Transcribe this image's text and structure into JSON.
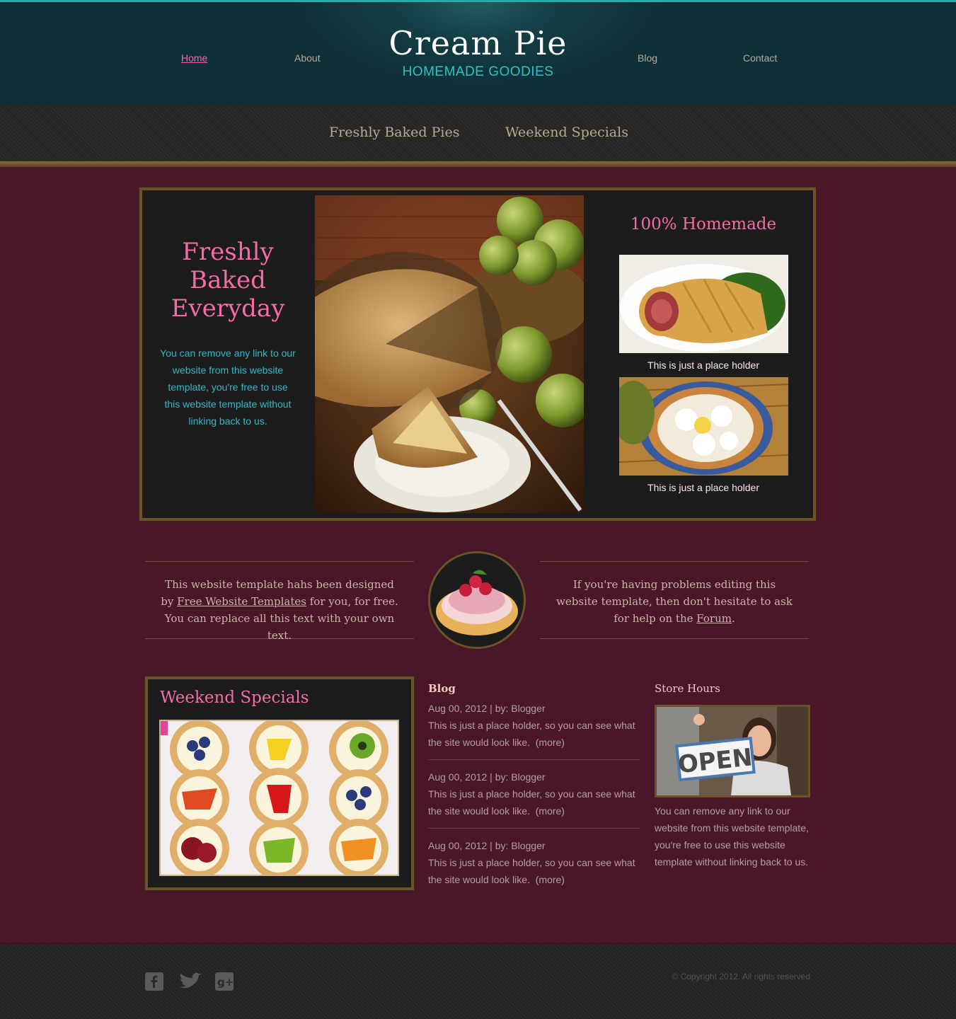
{
  "site": {
    "title": "Cream Pie",
    "tagline": "HOMEMADE GOODIES"
  },
  "nav": {
    "home": "Home",
    "about": "About",
    "blog": "Blog",
    "contact": "Contact",
    "active": "Home"
  },
  "subnav": {
    "item1": "Freshly Baked Pies",
    "item2": "Weekend Specials"
  },
  "featured": {
    "title_line1": "Freshly",
    "title_line2": "Baked",
    "title_line3": "Everyday",
    "text": "You can remove any link to our website from this website template, you're free to use this website template without linking back to us.",
    "side_title": "100% Homemade",
    "caption1": "This is just a place holder",
    "caption2": "This is just a place holder"
  },
  "intro": {
    "left_text_1": "This website template hahs been designed by",
    "left_link": "Free Website Templates",
    "left_text_2": "for you, for free. You can replace all this text with your own text.",
    "right_text_1": "If you're having problems editing this website template, then don't hesitate to ask for help on the",
    "right_link": "Forum",
    "right_text_2": "."
  },
  "weekend": {
    "title": "Weekend Specials"
  },
  "blog": {
    "title": "Blog",
    "posts": [
      {
        "meta": "Aug 00, 2012 | by: Blogger",
        "text": "This is just a place holder, so you can see what the site would look like.",
        "more": "(more)"
      },
      {
        "meta": "Aug 00, 2012 | by: Blogger",
        "text": "This is just a place holder, so you can see what the site would look like.",
        "more": "(more)"
      },
      {
        "meta": "Aug 00, 2012 | by: Blogger",
        "text": "This is just a place holder, so you can see what the site would look like.",
        "more": "(more)"
      }
    ]
  },
  "store": {
    "title": "Store Hours",
    "sign": "OPEN",
    "text": "You can remove any link to our website from this website template, you're free to use this website template without linking back to us."
  },
  "footer": {
    "copyright": "© Copyright 2012. All rights reserved",
    "social": [
      "facebook-icon",
      "twitter-icon",
      "google-plus-icon"
    ]
  },
  "colors": {
    "accent_pink": "#f46ba8",
    "accent_teal": "#2ec0c8",
    "body_bg": "#4a1728",
    "frame_gold": "#6b5329"
  }
}
